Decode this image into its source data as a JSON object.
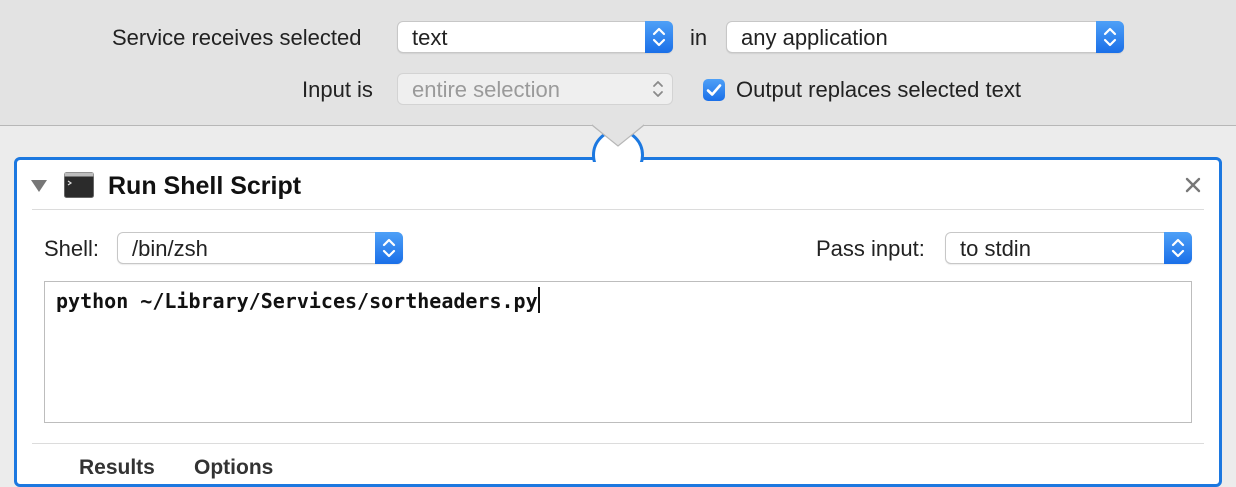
{
  "service_header": {
    "receives_label": "Service receives selected",
    "receives_value": "text",
    "in_label": "in",
    "application_value": "any application",
    "input_is_label": "Input is",
    "input_is_value": "entire selection",
    "output_replaces_label": "Output replaces selected text",
    "output_replaces_checked": true
  },
  "action": {
    "title": "Run Shell Script",
    "shell_label": "Shell:",
    "shell_value": "/bin/zsh",
    "pass_input_label": "Pass input:",
    "pass_input_value": "to stdin",
    "script": "python ~/Library/Services/sortheaders.py",
    "tabs": [
      "Results",
      "Options"
    ]
  },
  "icons": {
    "collapse": "disclosure-triangle-icon",
    "terminal": "terminal-icon",
    "close": "close-icon",
    "stepper": "up-down-chevron-icon",
    "checkmark": "checkmark-icon"
  },
  "colors": {
    "accent": "#1c78e0",
    "panel_bg": "#e3e3e3"
  }
}
